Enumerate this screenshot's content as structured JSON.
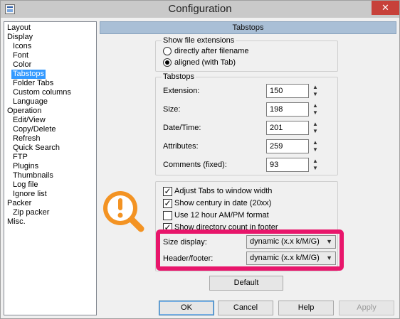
{
  "window": {
    "title": "Configuration",
    "close_glyph": "✕"
  },
  "tree": {
    "items": [
      {
        "label": "Layout",
        "indent": 0
      },
      {
        "label": "Display",
        "indent": 0
      },
      {
        "label": "Icons",
        "indent": 1
      },
      {
        "label": "Font",
        "indent": 1
      },
      {
        "label": "Color",
        "indent": 1
      },
      {
        "label": "Tabstops",
        "indent": 1,
        "selected": true
      },
      {
        "label": "Folder Tabs",
        "indent": 1
      },
      {
        "label": "Custom columns",
        "indent": 1
      },
      {
        "label": "Language",
        "indent": 1
      },
      {
        "label": "Operation",
        "indent": 0
      },
      {
        "label": "Edit/View",
        "indent": 1
      },
      {
        "label": "Copy/Delete",
        "indent": 1
      },
      {
        "label": "Refresh",
        "indent": 1
      },
      {
        "label": "Quick Search",
        "indent": 1
      },
      {
        "label": "FTP",
        "indent": 1
      },
      {
        "label": "Plugins",
        "indent": 1
      },
      {
        "label": "Thumbnails",
        "indent": 1
      },
      {
        "label": "Log file",
        "indent": 1
      },
      {
        "label": "Ignore list",
        "indent": 1
      },
      {
        "label": "Packer",
        "indent": 0
      },
      {
        "label": "Zip packer",
        "indent": 1
      },
      {
        "label": "Misc.",
        "indent": 0
      }
    ]
  },
  "pane": {
    "header": "Tabstops",
    "file_ext_group": {
      "title": "Show file extensions",
      "option_direct": "directly after filename",
      "option_aligned": "aligned (with Tab)"
    },
    "tabstops_group": {
      "title": "Tabstops",
      "fields": [
        {
          "label": "Extension:",
          "value": "150"
        },
        {
          "label": "Size:",
          "value": "198"
        },
        {
          "label": "Date/Time:",
          "value": "201"
        },
        {
          "label": "Attributes:",
          "value": "259"
        },
        {
          "label": "Comments (fixed):",
          "value": "93"
        }
      ]
    },
    "options_group": {
      "adjust_tabs": {
        "label": "Adjust Tabs to window width",
        "checked": true
      },
      "show_century": {
        "label": "Show century in date (20xx)",
        "checked": true
      },
      "use_12h": {
        "label": "Use 12 hour AM/PM format",
        "checked": false
      },
      "dir_count": {
        "label": "Show directory count in footer",
        "checked": true
      },
      "size_display_label": "Size display:",
      "size_display_value": "dynamic (x.x k/M/G)",
      "header_footer_label": "Header/footer:",
      "header_footer_value": "dynamic (x.x k/M/G)"
    },
    "default_button": "Default"
  },
  "footer": {
    "ok": "OK",
    "cancel": "Cancel",
    "help": "Help",
    "apply": "Apply"
  },
  "colors": {
    "highlight": "#e8166b",
    "warning_badge": "#f39323",
    "selection": "#3399ff",
    "header_bar": "#a9bfd6"
  },
  "icons": {
    "warning_badge": "warning-magnifier-icon",
    "check": "✓",
    "spin_up": "▲",
    "spin_down": "▼",
    "dropdown": "▼"
  }
}
